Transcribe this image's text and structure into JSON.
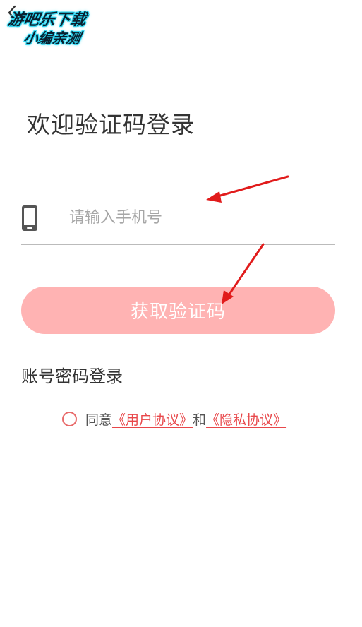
{
  "watermark": {
    "line1": "游吧乐下载",
    "line2": "小编亲测"
  },
  "page": {
    "title": "欢迎验证码登录"
  },
  "phone_input": {
    "placeholder": "请输入手机号",
    "value": ""
  },
  "get_code_button": {
    "label": "获取验证码",
    "color": "#ffb3b3"
  },
  "password_login": {
    "label": "账号密码登录"
  },
  "agreement": {
    "prefix": "同意",
    "user_agreement": "《用户协议》",
    "conjunction": "和",
    "privacy_agreement": "《隐私协议》",
    "checked": false
  },
  "icons": {
    "back": "chevron-left-icon",
    "phone": "mobile-phone-icon"
  },
  "colors": {
    "accent": "#e8474a",
    "annotation_arrow": "#e11b1b"
  }
}
